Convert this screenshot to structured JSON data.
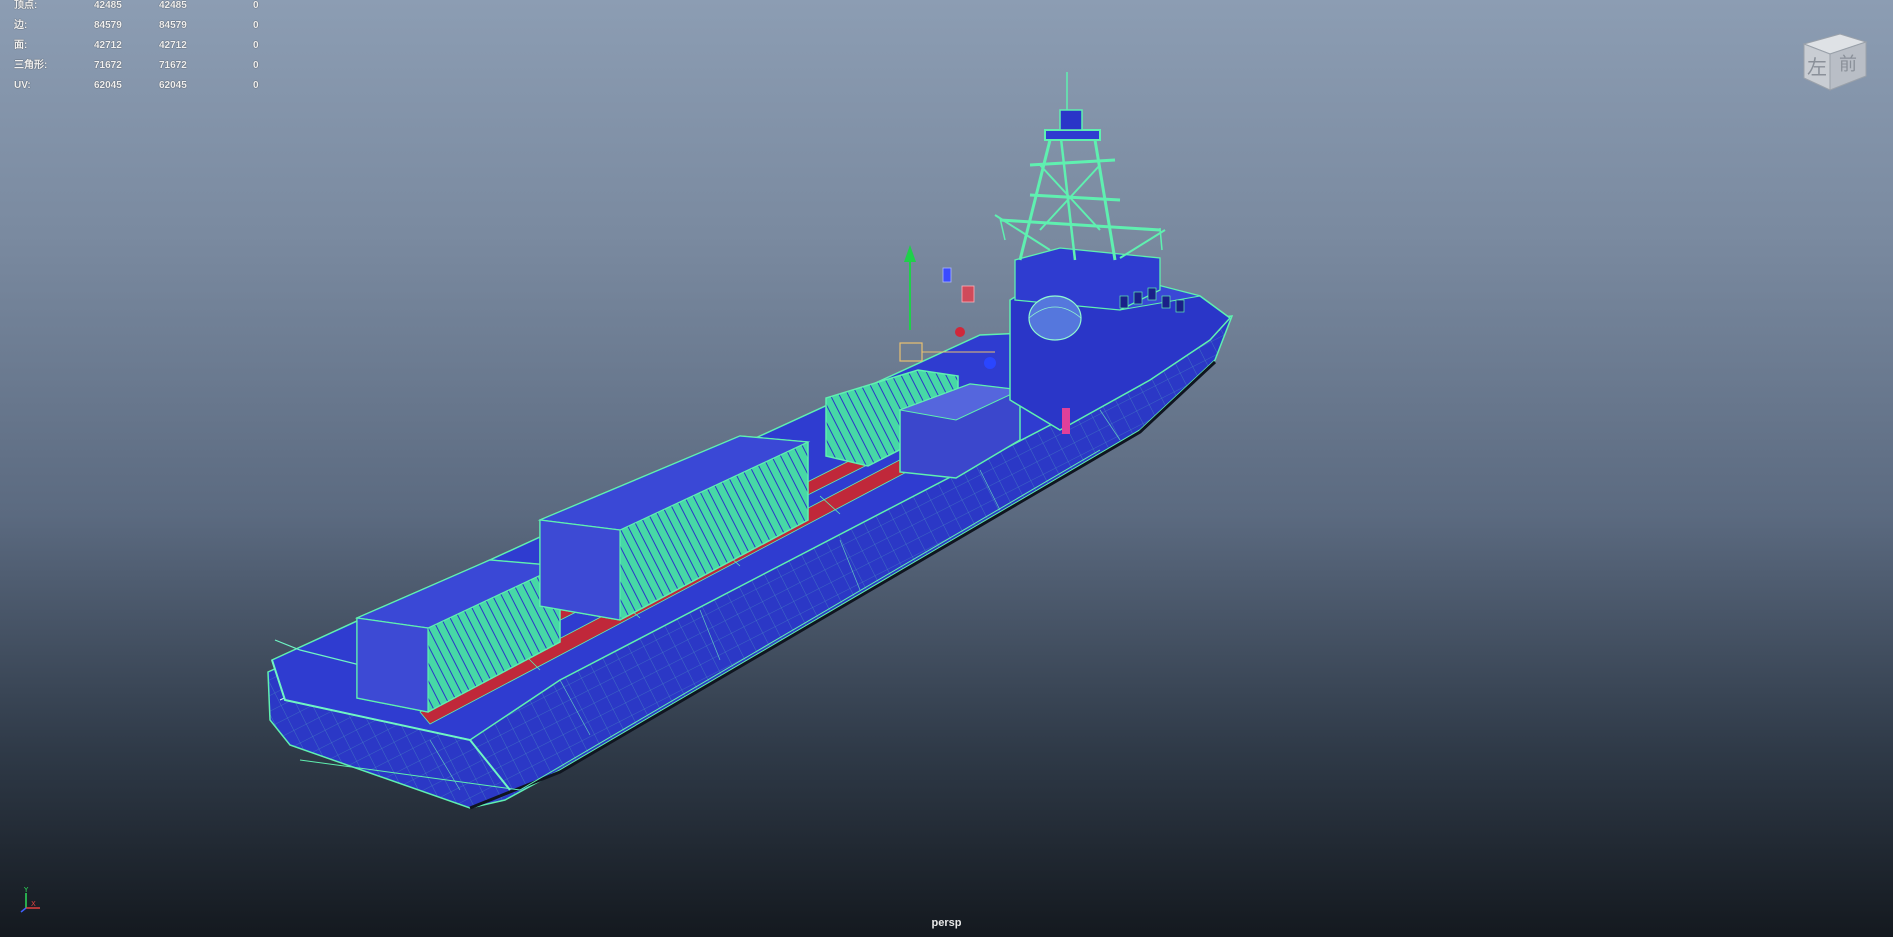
{
  "hud": {
    "rows": [
      {
        "label": "顶点:",
        "v1": "42485",
        "v2": "42485",
        "v3": "0"
      },
      {
        "label": "边:",
        "v1": "84579",
        "v2": "84579",
        "v3": "0"
      },
      {
        "label": "面:",
        "v1": "42712",
        "v2": "42712",
        "v3": "0"
      },
      {
        "label": "三角形:",
        "v1": "71672",
        "v2": "71672",
        "v3": "0"
      },
      {
        "label": "UV:",
        "v1": "62045",
        "v2": "62045",
        "v3": "0"
      }
    ]
  },
  "viewcube": {
    "left_face": "左",
    "front_face": "前"
  },
  "camera": {
    "name": "persp"
  },
  "axis": {
    "y": "Y",
    "x": "X"
  },
  "colors": {
    "wire": "#5ff0b0",
    "hull": "#2a36c8",
    "deck_red": "#c0283a",
    "bg_top": "#8c9db3",
    "bg_bottom": "#14191f"
  }
}
